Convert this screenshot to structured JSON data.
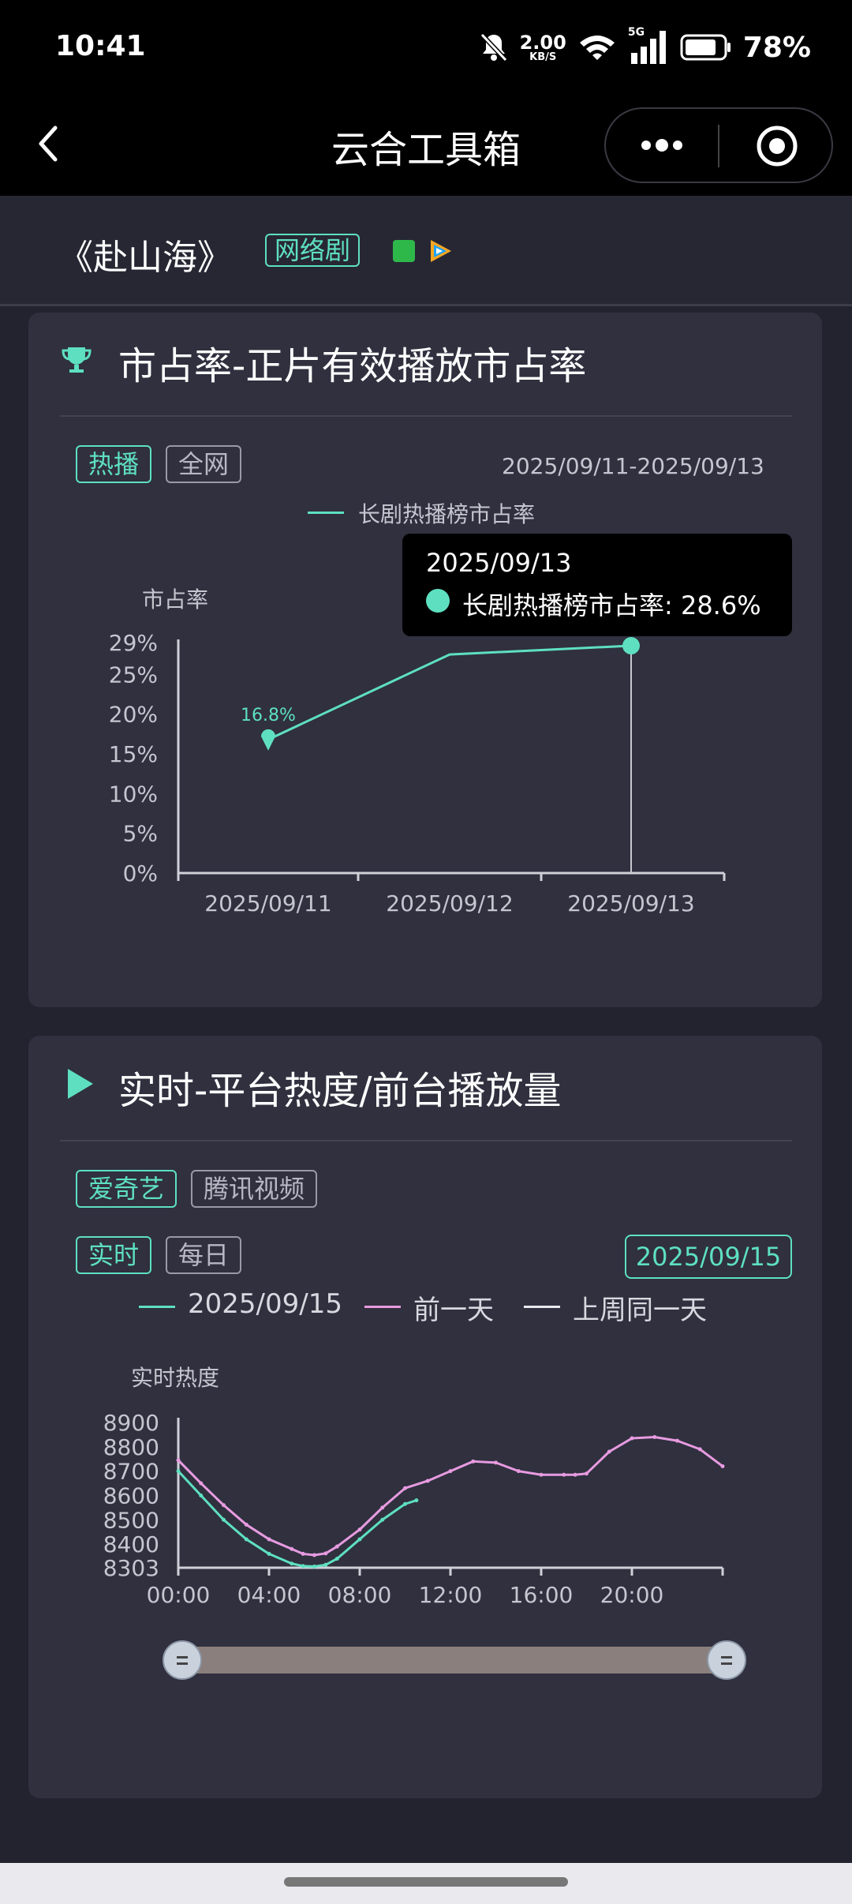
{
  "status_bar": {
    "time": "10:41",
    "net_speed": "2.00",
    "net_unit": "KB/S",
    "network": "5G",
    "battery": "78%"
  },
  "nav": {
    "title": "云合工具箱"
  },
  "show": {
    "title": "《赴山海》",
    "genre_tag": "网络剧",
    "platform_icons": [
      "iqiyi-icon",
      "tencent-video-icon"
    ]
  },
  "card1": {
    "title": "市占率-正片有效播放市占率",
    "tags": [
      "热播",
      "全网"
    ],
    "date_range": "2025/09/11-2025/09/13",
    "tooltip": {
      "date": "2025/09/13",
      "text": "长剧热播榜市占率: 28.6%"
    }
  },
  "card2": {
    "title": "实时-平台热度/前台播放量",
    "platform_tags": [
      "爱奇艺",
      "腾讯视频"
    ],
    "mode_tags": [
      "实时",
      "每日"
    ],
    "date": "2025/09/15"
  },
  "chart_data": [
    {
      "type": "line",
      "ylabel": "市占率",
      "x": [
        "2025/09/11",
        "2025/09/12",
        "2025/09/13"
      ],
      "series": [
        {
          "name": "长剧热播榜市占率",
          "values": [
            16.8,
            27.5,
            28.6
          ],
          "color": "#5ee0c0"
        }
      ],
      "yticks": [
        "0%",
        "5%",
        "10%",
        "15%",
        "20%",
        "25%",
        "29%"
      ],
      "ylim": [
        0,
        29
      ],
      "data_labels": [
        "16.8%"
      ],
      "legend": "top-center",
      "grid": false
    },
    {
      "type": "line",
      "ylabel": "实时热度",
      "xticks": [
        "00:00",
        "04:00",
        "08:00",
        "12:00",
        "16:00",
        "20:00"
      ],
      "yticks": [
        "8303",
        "8400",
        "8500",
        "8600",
        "8700",
        "8800",
        "8900"
      ],
      "ylim": [
        8303,
        8900
      ],
      "legend": "top-center",
      "grid": false,
      "series": [
        {
          "name": "2025/09/15",
          "color": "#5ee0c0",
          "hours": [
            0,
            1,
            2,
            3,
            4,
            5,
            5.5,
            6,
            6.5,
            7,
            8,
            9,
            10,
            10.5
          ],
          "values": [
            8700,
            8600,
            8500,
            8420,
            8360,
            8320,
            8310,
            8308,
            8315,
            8340,
            8420,
            8500,
            8565,
            8580
          ]
        },
        {
          "name": "前一天",
          "color": "#e79be0",
          "hours": [
            0,
            1,
            2,
            3,
            4,
            5,
            5.5,
            6,
            6.5,
            7,
            8,
            9,
            10,
            11,
            12,
            13,
            14,
            15,
            16,
            17,
            17.5,
            18,
            19,
            20,
            21,
            22,
            23,
            24
          ],
          "values": [
            8745,
            8650,
            8560,
            8480,
            8420,
            8380,
            8360,
            8355,
            8362,
            8390,
            8460,
            8550,
            8630,
            8660,
            8700,
            8740,
            8735,
            8700,
            8685,
            8685,
            8685,
            8690,
            8780,
            8835,
            8840,
            8825,
            8790,
            8720
          ]
        },
        {
          "name": "上周同一天",
          "color": "#e8e8ee",
          "hours": [],
          "values": []
        }
      ]
    }
  ]
}
